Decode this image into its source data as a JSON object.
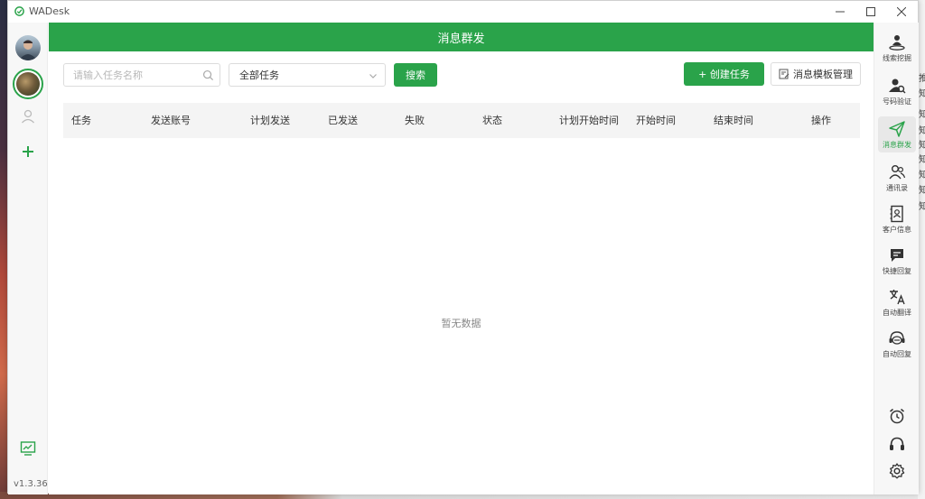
{
  "window": {
    "title": "WADesk"
  },
  "header": {
    "title": "消息群发"
  },
  "toolbar": {
    "search_placeholder": "请输入任务名称",
    "filter_selected": "全部任务",
    "search_button": "搜索",
    "create_button": "+ 创建任务",
    "template_button": "消息模板管理"
  },
  "table": {
    "columns": [
      "任务",
      "发送账号",
      "计划发送",
      "已发送",
      "失败",
      "状态",
      "计划开始时间",
      "开始时间",
      "结束时间",
      "操作"
    ],
    "empty_text": "暂无数据"
  },
  "right_nav": {
    "items": [
      {
        "label": "线索挖掘",
        "icon": "user-pin-icon"
      },
      {
        "label": "号码验证",
        "icon": "user-search-icon"
      },
      {
        "label": "消息群发",
        "icon": "send-icon",
        "active": true
      },
      {
        "label": "通讯录",
        "icon": "contacts-icon"
      },
      {
        "label": "客户信息",
        "icon": "customer-card-icon"
      },
      {
        "label": "快捷回复",
        "icon": "quick-reply-icon"
      },
      {
        "label": "自动翻译",
        "icon": "translate-icon"
      },
      {
        "label": "自动回复",
        "icon": "auto-reply-icon"
      }
    ]
  },
  "left_rail": {
    "version": "v1.3.36"
  },
  "background_peek": [
    "推",
    "知",
    "知",
    "知",
    "知",
    "知",
    "知",
    "知",
    "知"
  ],
  "colors": {
    "accent": "#2aa34a",
    "header_bg": "#2aa34a",
    "table_head_bg": "#f4f4f4"
  }
}
